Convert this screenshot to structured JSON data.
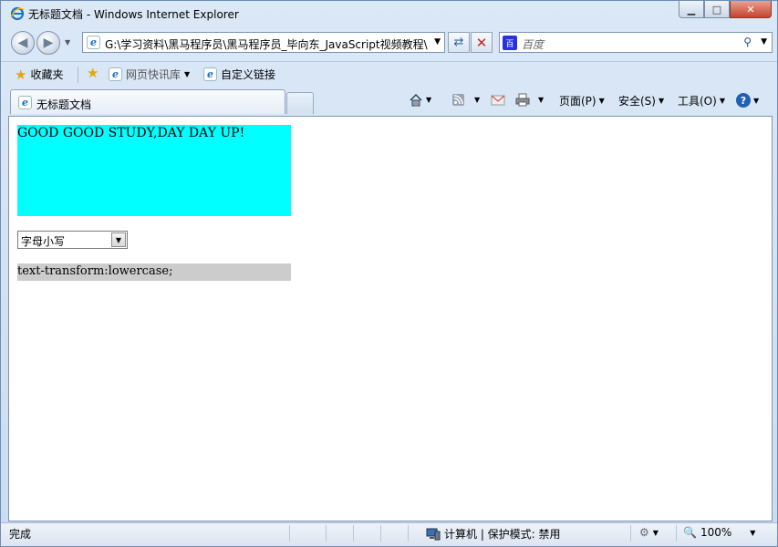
{
  "window": {
    "title": "无标题文档 - Windows Internet Explorer",
    "minimize": "▁",
    "maximize": "□",
    "close": "✕"
  },
  "address": {
    "url": "G:\\学习资料\\黑马程序员\\黑马程序员_毕向东_JavaScript视频教程\\"
  },
  "search": {
    "engine_label": "百度",
    "placeholder": "百度"
  },
  "favorites": {
    "favorites_label": "收藏夹",
    "webslice_label": "网页快讯库",
    "custom_links_label": "自定义链接"
  },
  "tab": {
    "label": "无标题文档"
  },
  "commands": {
    "page": "页面(P)",
    "safety": "安全(S)",
    "tools": "工具(O)",
    "help": "?"
  },
  "page": {
    "banner_text": "GOOD GOOD STUDY,DAY DAY UP!",
    "select_value": "字母小写",
    "css_text": "text-transform:lowercase;"
  },
  "status": {
    "text": "完成",
    "zone": "计算机 | 保护模式: 禁用",
    "zoom": "100%"
  },
  "colors": {
    "banner_bg": "#00ffff",
    "css_bg": "#cccccc"
  }
}
